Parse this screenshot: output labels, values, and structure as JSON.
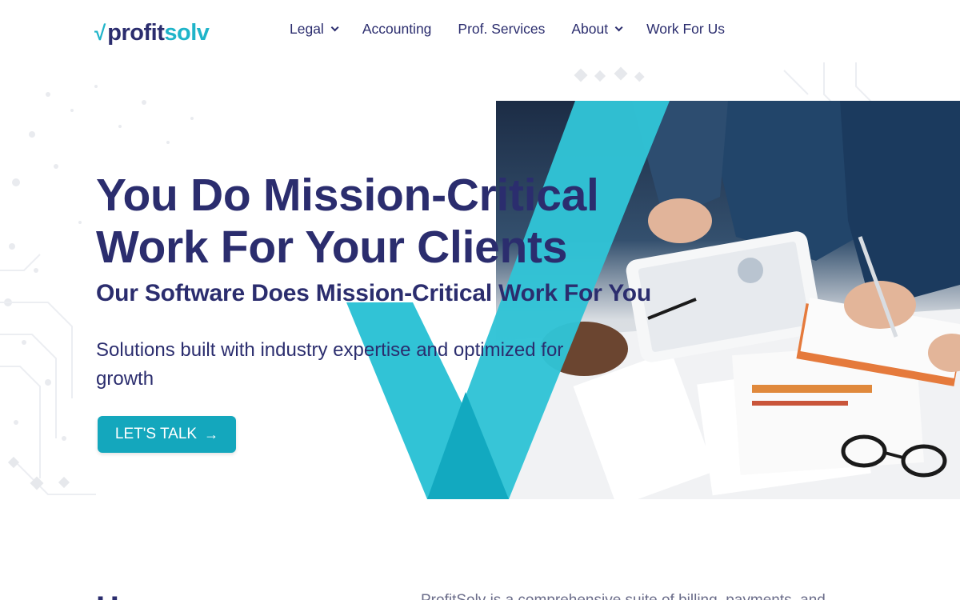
{
  "brand": {
    "logo_check": "√",
    "logo_part1": "profit",
    "logo_part2": "solv",
    "colors": {
      "navy": "#2b2d6e",
      "teal": "#1fb4c9",
      "button": "#14a7bd"
    }
  },
  "nav": {
    "items": [
      {
        "label": "Legal",
        "has_dropdown": true
      },
      {
        "label": "Accounting",
        "has_dropdown": false
      },
      {
        "label": "Prof. Services",
        "has_dropdown": false
      },
      {
        "label": "About",
        "has_dropdown": true
      },
      {
        "label": "Work For Us",
        "has_dropdown": false
      }
    ]
  },
  "hero": {
    "title_line1": "You Do Mission-Critical",
    "title_line2": "Work For Your Clients",
    "subtitle": "Our Software Does Mission-Critical Work For You",
    "description": "Solutions built with industry expertise and optimized for growth",
    "cta_label": "LET'S TALK",
    "cta_icon": "arrow-right-icon"
  },
  "section2": {
    "heading_partial": "H",
    "text_partial": "ProfitSolv is a comprehensive suite of billing, payments, and"
  }
}
